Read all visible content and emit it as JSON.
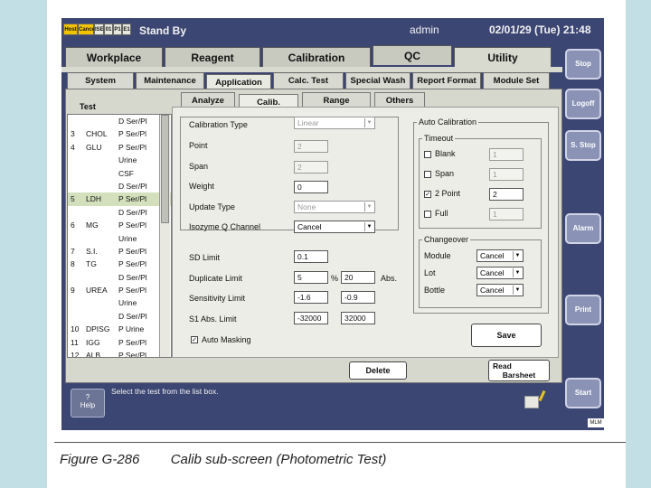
{
  "status": {
    "leds": [
      "Host",
      "Cancel",
      "ISE",
      "01",
      "P1",
      "E1"
    ],
    "mode": "Stand By",
    "user": "admin",
    "datetime": "02/01/29 (Tue) 21:48"
  },
  "right_buttons": [
    "Stop",
    "Logoff",
    "S. Stop",
    "Alarm",
    "Print",
    "Start"
  ],
  "main_tabs": [
    "Workplace",
    "Reagent",
    "Calibration",
    "QC",
    "Utility"
  ],
  "utility_tabs": [
    "System",
    "Maintenance",
    "Application",
    "Calc. Test",
    "Special Wash",
    "Report Format",
    "Module Set"
  ],
  "app_tabs": [
    "Analyze",
    "Calib.",
    "Range",
    "Others"
  ],
  "test_list": {
    "header": "Test",
    "rows": [
      {
        "num": "",
        "name": "",
        "type": "D Ser/Pl"
      },
      {
        "num": "3",
        "name": "CHOL",
        "type": "P Ser/Pl"
      },
      {
        "num": "4",
        "name": "GLU",
        "type": "P Ser/Pl"
      },
      {
        "num": "",
        "name": "",
        "type": "Urine"
      },
      {
        "num": "",
        "name": "",
        "type": "CSF"
      },
      {
        "num": "",
        "name": "",
        "type": "D Ser/Pl"
      },
      {
        "num": "5",
        "name": "LDH",
        "type": "P Ser/Pl"
      },
      {
        "num": "",
        "name": "",
        "type": "D Ser/Pl"
      },
      {
        "num": "6",
        "name": "MG",
        "type": "P Ser/Pl"
      },
      {
        "num": "",
        "name": "",
        "type": "Urine"
      },
      {
        "num": "7",
        "name": "S.I.",
        "type": "P Ser/Pl"
      },
      {
        "num": "8",
        "name": "TG",
        "type": "P Ser/Pl"
      },
      {
        "num": "",
        "name": "",
        "type": "D Ser/Pl"
      },
      {
        "num": "9",
        "name": "UREA",
        "type": "P Ser/Pl"
      },
      {
        "num": "",
        "name": "",
        "type": "Urine"
      },
      {
        "num": "",
        "name": "",
        "type": "D Ser/Pl"
      },
      {
        "num": "10",
        "name": "DPISG",
        "type": "P Urine"
      },
      {
        "num": "11",
        "name": "IGG",
        "type": "P Ser/Pl"
      },
      {
        "num": "12",
        "name": "ALB",
        "type": "P Ser/Pl"
      }
    ]
  },
  "calib": {
    "calibration_type": {
      "label": "Calibration Type",
      "value": "Linear"
    },
    "point": {
      "label": "Point",
      "value": "2"
    },
    "span": {
      "label": "Span",
      "value": "2"
    },
    "weight": {
      "label": "Weight",
      "value": "0"
    },
    "update_type": {
      "label": "Update Type",
      "value": "None"
    },
    "isozyme": {
      "label": "Isozyme Q Channel",
      "value": "Cancel"
    },
    "sd_limit": {
      "label": "SD Limit",
      "value": "0.1"
    },
    "duplicate_limit": {
      "label": "Duplicate Limit",
      "value": "5",
      "unit": "%",
      "value2": "20",
      "unit2": "Abs."
    },
    "sensitivity_limit": {
      "label": "Sensitivity Limit",
      "low": "-1.6",
      "high": "-0.9"
    },
    "s1_abs_limit": {
      "label": "S1 Abs. Limit",
      "low": "-32000",
      "high": "32000"
    },
    "auto_masking": {
      "label": "Auto Masking",
      "checked": true
    }
  },
  "auto_calibration": {
    "title": "Auto Calibration",
    "timeout": {
      "title": "Timeout",
      "items": [
        {
          "label": "Blank",
          "checked": false,
          "value": "1"
        },
        {
          "label": "Span",
          "checked": false,
          "value": "1"
        },
        {
          "label": "2 Point",
          "checked": true,
          "value": "2"
        },
        {
          "label": "Full",
          "checked": false,
          "value": "1"
        }
      ]
    },
    "changeover": {
      "title": "Changeover",
      "items": [
        {
          "label": "Module",
          "value": "Cancel"
        },
        {
          "label": "Lot",
          "value": "Cancel"
        },
        {
          "label": "Bottle",
          "value": "Cancel"
        }
      ]
    }
  },
  "buttons": {
    "save": "Save",
    "delete": "Delete",
    "read_barsheet_1": "Read",
    "read_barsheet_2": "Barsheet",
    "help_q": "?",
    "help": "Help"
  },
  "message": "Select the test from the list box.",
  "version_tag": "MLM",
  "caption": {
    "figure": "Figure G-286",
    "text": "Calib sub-screen (Photometric Test)"
  }
}
